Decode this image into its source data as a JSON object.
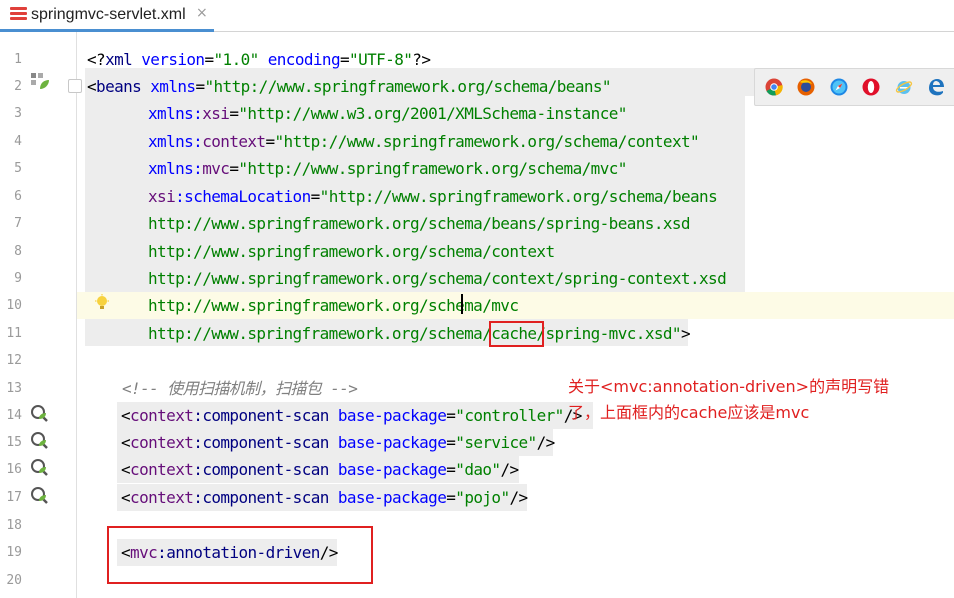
{
  "tab": {
    "title": "springmvc-servlet.xml",
    "close": "×"
  },
  "line_numbers": [
    "1",
    "2",
    "3",
    "4",
    "5",
    "6",
    "7",
    "8",
    "9",
    "10",
    "11",
    "12",
    "13",
    "14",
    "15",
    "16",
    "17",
    "18",
    "19",
    "20"
  ],
  "code": {
    "l1": {
      "lt": "<?",
      "tag": "xml",
      "sp": " ",
      "a1": "version",
      "eq1": "=",
      "v1": "\"1.0\"",
      "sp2": " ",
      "a2": "encoding",
      "eq2": "=",
      "v2": "\"UTF-8\"",
      "gt": "?>"
    },
    "l2": {
      "lt": "<",
      "tag": "beans",
      "sp": " ",
      "attr": "xmlns",
      "eq": "=",
      "val": "\"http://www.springframework.org/schema/beans\""
    },
    "l3": {
      "ns": "xmlns",
      "colon": ":",
      "attr": "xsi",
      "eq": "=",
      "val": "\"http://www.w3.org/2001/XMLSchema-instance\""
    },
    "l4": {
      "ns": "xmlns",
      "colon": ":",
      "attr": "context",
      "eq": "=",
      "val": "\"http://www.springframework.org/schema/context\""
    },
    "l5": {
      "ns": "xmlns",
      "colon": ":",
      "attr": "mvc",
      "eq": "=",
      "val": "\"http://www.springframework.org/schema/mvc\""
    },
    "l6": {
      "ns": "xsi",
      "colon": ":",
      "attr": "schemaLocation",
      "eq": "=",
      "val": "\"http://www.springframework.org/schema/beans"
    },
    "l7": {
      "val": "http://www.springframework.org/schema/beans/spring-beans.xsd"
    },
    "l8": {
      "val": "http://www.springframework.org/schema/context"
    },
    "l9": {
      "val": "http://www.springframework.org/schema/context/spring-context.xsd"
    },
    "l10": {
      "val": "http://www.springframework.org/schema/mvc"
    },
    "l11": {
      "val_a": "http://www.springframework.org/schema/",
      "val_b": "cache/",
      "val_c": "spring-mvc.xsd\"",
      "gt": ">"
    },
    "l13": {
      "comment": "<!-- 使用扫描机制，扫描包 -->"
    },
    "l14": {
      "lt": "<",
      "ns": "context",
      "colon": ":",
      "tag": "component-scan",
      "sp": " ",
      "attr": "base-package",
      "eq": "=",
      "val": "\"controller\"",
      "end": "/>"
    },
    "l15": {
      "lt": "<",
      "ns": "context",
      "colon": ":",
      "tag": "component-scan",
      "sp": " ",
      "attr": "base-package",
      "eq": "=",
      "val": "\"service\"",
      "end": "/>"
    },
    "l16": {
      "lt": "<",
      "ns": "context",
      "colon": ":",
      "tag": "component-scan",
      "sp": " ",
      "attr": "base-package",
      "eq": "=",
      "val": "\"dao\"",
      "end": "/>"
    },
    "l17": {
      "lt": "<",
      "ns": "context",
      "colon": ":",
      "tag": "component-scan",
      "sp": " ",
      "attr": "base-package",
      "eq": "=",
      "val": "\"pojo\"",
      "end": "/>"
    },
    "l19": {
      "lt": "<",
      "ns": "mvc",
      "colon": ":",
      "tag": "annotation-driven",
      "end": "/>"
    }
  },
  "annotation": {
    "line1": "关于<mvc:annotation-driven>的声明写错",
    "line2": "了，上面框内的cache应该是mvc"
  },
  "browsers": [
    "chrome-icon",
    "firefox-icon",
    "safari-icon",
    "opera-icon",
    "ie-icon",
    "edge-icon"
  ],
  "colors": {
    "tag": "#000080",
    "attribute": "#0000ff",
    "namespace": "#660e7a",
    "string": "#008000",
    "comment": "#808080",
    "highlight_box": "#e02020"
  }
}
